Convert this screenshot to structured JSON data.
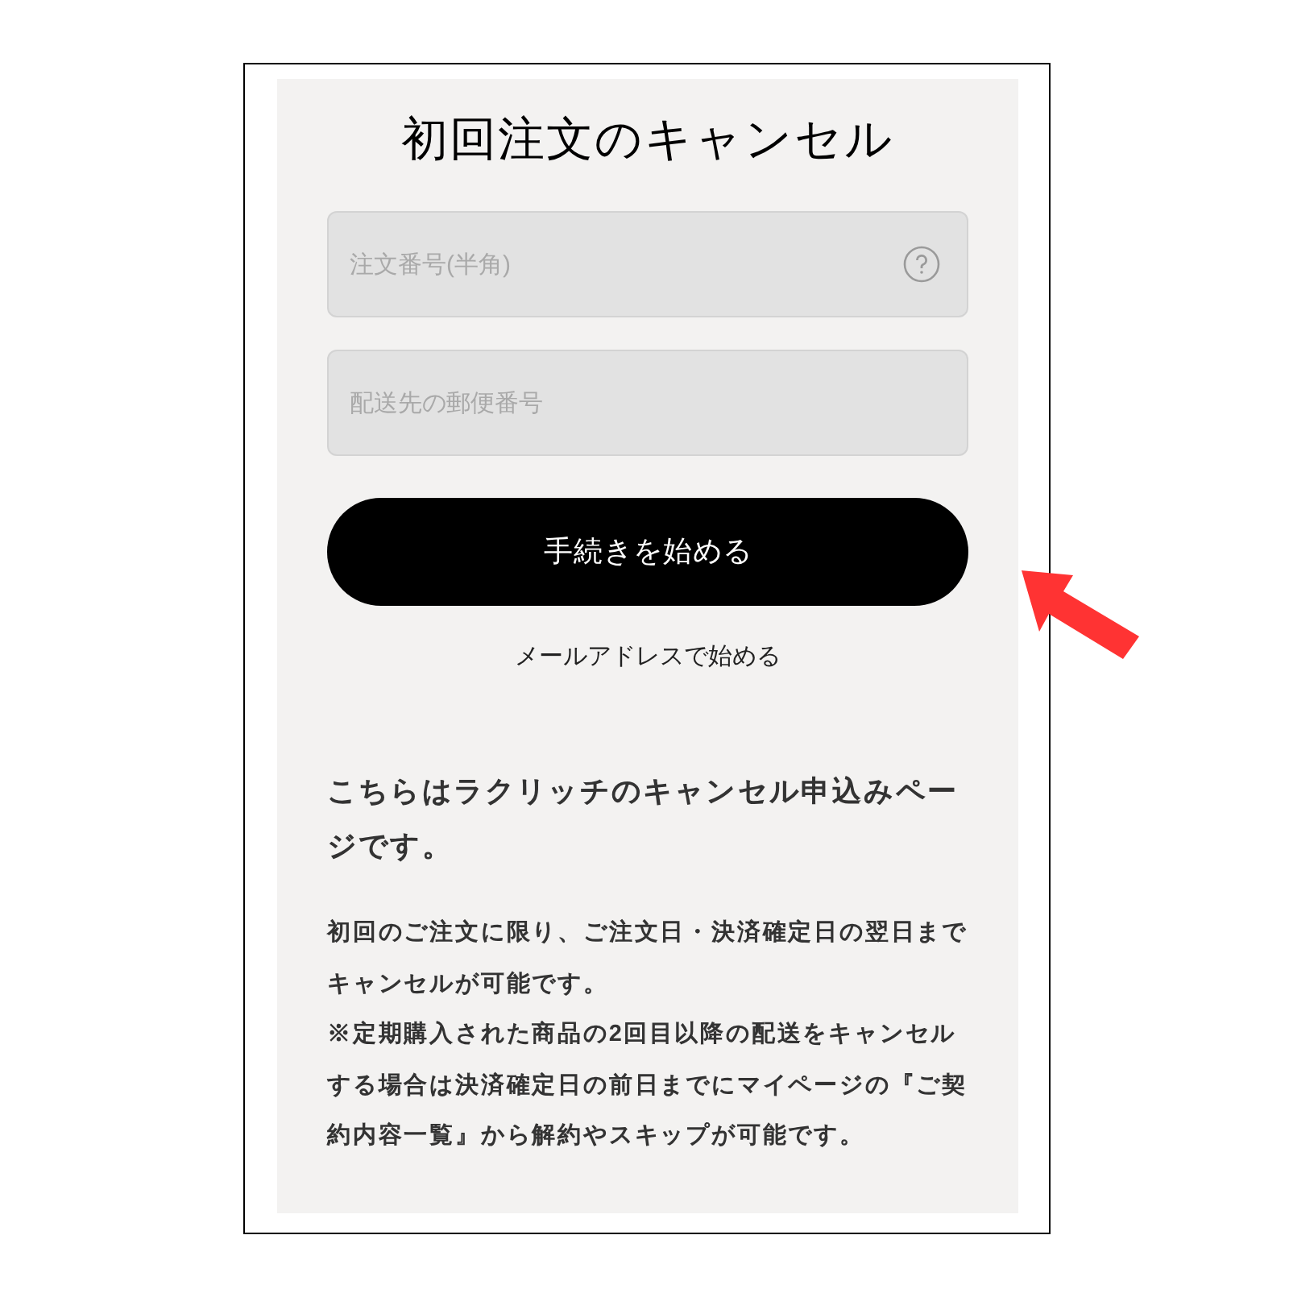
{
  "title": "初回注文のキャンセル",
  "fields": [
    {
      "placeholder": "注文番号(半角)",
      "help": true
    },
    {
      "placeholder": "配送先の郵便番号",
      "help": false
    }
  ],
  "submit_button": "手続きを始める",
  "email_link": "メールアドレスで始める",
  "intro": "こちらはラクリッチのキャンセル申込みページです。",
  "notes": [
    "初回のご注文に限り、ご注文日・決済確定日の翌日までキャンセルが可能です。",
    "※定期購入された商品の2回目以降の配送をキャンセルする場合は決済確定日の前日までにマイページの『ご契約内容一覧』から解約やスキップが可能です。"
  ]
}
